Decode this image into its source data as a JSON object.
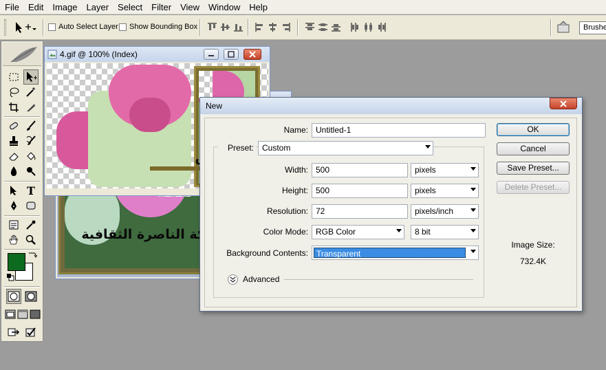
{
  "menubar": {
    "items": [
      "File",
      "Edit",
      "Image",
      "Layer",
      "Select",
      "Filter",
      "View",
      "Window",
      "Help"
    ]
  },
  "options_bar": {
    "auto_select_layer": "Auto Select Layer",
    "show_bounding_box": "Show Bounding Box",
    "brushes_tab": "Brushes"
  },
  "document_window": {
    "title": "4.gif @ 100% (Index)",
    "arabic_text_top": "ساس",
    "arabic_text_bottom": "كة الناصرة الثقافية"
  },
  "dialog": {
    "title": "New",
    "name_label": "Name:",
    "name_value": "Untitled-1",
    "preset_label": "Preset:",
    "preset_value": "Custom",
    "width_label": "Width:",
    "width_value": "500",
    "width_unit": "pixels",
    "height_label": "Height:",
    "height_value": "500",
    "height_unit": "pixels",
    "resolution_label": "Resolution:",
    "resolution_value": "72",
    "resolution_unit": "pixels/inch",
    "color_mode_label": "Color Mode:",
    "color_mode_value": "RGB Color",
    "bit_depth_value": "8 bit",
    "background_label": "Background Contents:",
    "background_value": "Transparent",
    "advanced_label": "Advanced",
    "ok_label": "OK",
    "cancel_label": "Cancel",
    "save_preset_label": "Save Preset...",
    "delete_preset_label": "Delete Preset...",
    "image_size_label": "Image Size:",
    "image_size_value": "732.4K"
  },
  "colors": {
    "foreground": "#0d6b1f",
    "background": "#ffffff",
    "selection": "#3a8de3"
  }
}
